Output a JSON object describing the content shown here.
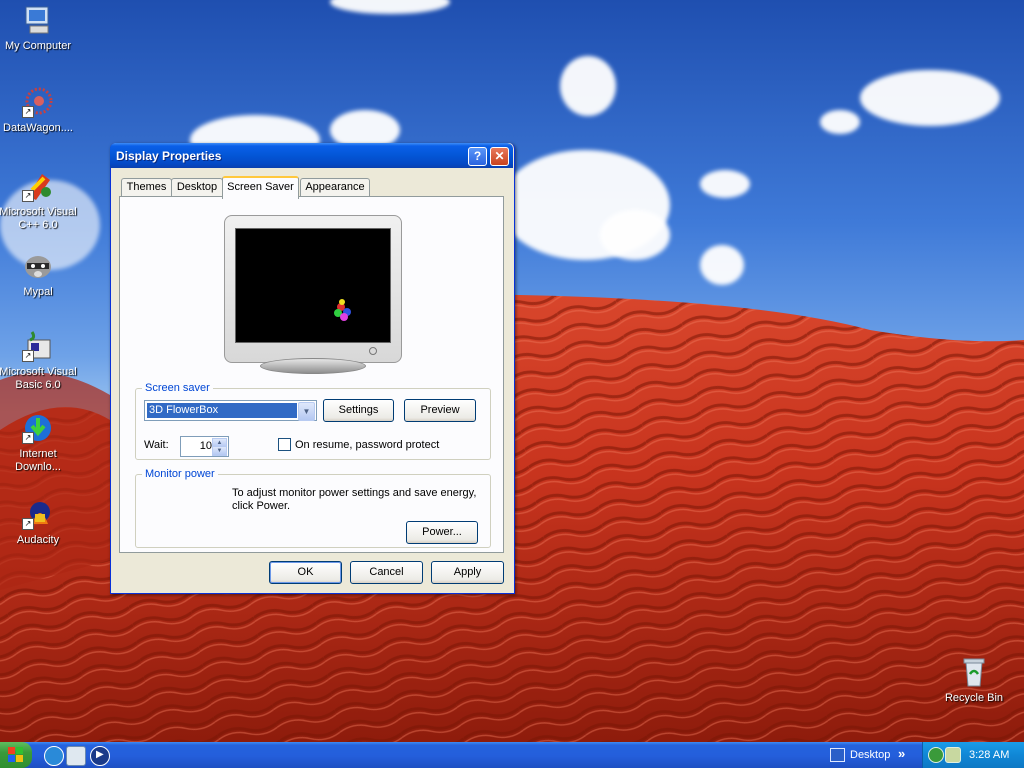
{
  "desktop": {
    "icons": [
      {
        "label": "My Computer",
        "icon": "my-computer-icon"
      },
      {
        "label": "DataWagon....",
        "icon": "datawagon-icon"
      },
      {
        "label": "Microsoft Visual\nC++ 6.0",
        "icon": "visual-cpp-icon"
      },
      {
        "label": "Mypal",
        "icon": "mypal-icon"
      },
      {
        "label": "Microsoft Visual\nBasic 6.0",
        "icon": "visual-basic-icon"
      },
      {
        "label": "Internet\nDownlo...",
        "icon": "internet-download-icon"
      },
      {
        "label": "Audacity",
        "icon": "audacity-icon"
      },
      {
        "label": "Recycle Bin",
        "icon": "recycle-bin-icon"
      }
    ]
  },
  "window": {
    "title": "Display Properties",
    "help_glyph": "?",
    "close_glyph": "✕",
    "tabs": [
      {
        "label": "Themes"
      },
      {
        "label": "Desktop"
      },
      {
        "label": "Screen Saver",
        "active": true
      },
      {
        "label": "Appearance"
      }
    ],
    "screen_saver": {
      "group_label": "Screen saver",
      "selected": "3D FlowerBox",
      "settings_label": "Settings",
      "preview_label": "Preview",
      "wait_label": "Wait:",
      "wait_value": "10",
      "password_label": "On resume, password protect"
    },
    "monitor_power": {
      "group_label": "Monitor power",
      "description": "To adjust monitor power settings and save energy, click Power.",
      "power_label": "Power..."
    },
    "ok_label": "OK",
    "cancel_label": "Cancel",
    "apply_label": "Apply"
  },
  "taskbar": {
    "desktop_label": "Desktop",
    "chevron": "»",
    "clock": "3:28 AM"
  }
}
